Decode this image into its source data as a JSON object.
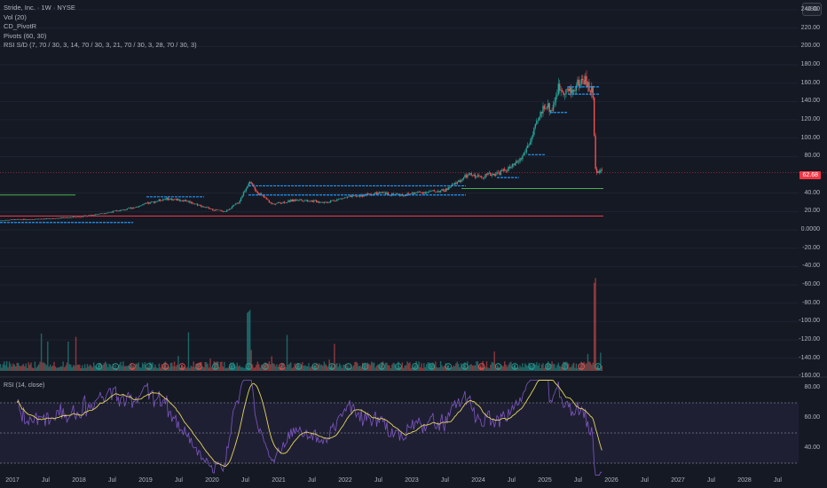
{
  "legend": {
    "symbol": "Stride, Inc. · 1W · NYSE",
    "volume": "Vol (20)",
    "pivot_r": "CD_PivotR",
    "pivots": "Pivots (60, 30)",
    "rsi_sd": "RSI S/D (7, 70 / 30, 3, 14, 70 / 30, 3, 21, 70 / 30, 3, 28, 70 / 30, 3)"
  },
  "currency": "USD",
  "last_price": "62.68",
  "price_axis": [
    "240.00",
    "220.00",
    "200.00",
    "180.00",
    "160.00",
    "140.00",
    "120.00",
    "100.00",
    "80.00",
    "40.00",
    "20.00",
    "0.0000",
    "-20.00",
    "-40.00",
    "-60.00",
    "-80.00",
    "-100.00",
    "-120.00",
    "-140.00",
    "-160.00"
  ],
  "rsi_panel": {
    "title": "RSI (14, close)",
    "axis": [
      "80.00",
      "60.00",
      "40.00"
    ],
    "bands": [
      70,
      50,
      30
    ]
  },
  "time_axis": [
    "2017",
    "Jul",
    "2018",
    "Jul",
    "2019",
    "Jul",
    "2020",
    "Jul",
    "2021",
    "Jul",
    "2022",
    "Jul",
    "2023",
    "Jul",
    "2024",
    "Jul",
    "2025",
    "Jul",
    "2026",
    "Jul",
    "2027",
    "Jul",
    "2028",
    "Jul"
  ],
  "colors": {
    "up": "#26a69a",
    "down": "#ef5350",
    "rsi": "#7e57c2",
    "rsi_ma": "#e6d55c",
    "pivot": "#2196f3",
    "support": "#4caf50",
    "resistance": "#f23645"
  },
  "earnings_marker": "E",
  "chart_data": {
    "type": "line",
    "title": "Stride, Inc. · 1W · NYSE",
    "price_keypoints": [
      [
        2016.8,
        10
      ],
      [
        2017,
        11
      ],
      [
        2017.5,
        12
      ],
      [
        2018,
        14
      ],
      [
        2018.7,
        22
      ],
      [
        2019,
        28
      ],
      [
        2019.3,
        34
      ],
      [
        2019.6,
        32
      ],
      [
        2020,
        22
      ],
      [
        2020.2,
        20
      ],
      [
        2020.4,
        30
      ],
      [
        2020.55,
        52
      ],
      [
        2020.7,
        40
      ],
      [
        2020.9,
        28
      ],
      [
        2021.3,
        33
      ],
      [
        2021.7,
        30
      ],
      [
        2022,
        35
      ],
      [
        2022.5,
        40
      ],
      [
        2022.9,
        38
      ],
      [
        2023,
        40
      ],
      [
        2023.5,
        43
      ],
      [
        2023.85,
        60
      ],
      [
        2024,
        58
      ],
      [
        2024.3,
        62
      ],
      [
        2024.5,
        68
      ],
      [
        2024.65,
        78
      ],
      [
        2024.8,
        100
      ],
      [
        2025,
        138
      ],
      [
        2025.1,
        130
      ],
      [
        2025.2,
        155
      ],
      [
        2025.4,
        150
      ],
      [
        2025.5,
        160
      ],
      [
        2025.6,
        165
      ],
      [
        2025.68,
        150
      ],
      [
        2025.72,
        155
      ],
      [
        2025.76,
        65
      ],
      [
        2025.85,
        62.68
      ]
    ],
    "ylim": [
      -160,
      240
    ],
    "support_levels": [
      38,
      40
    ],
    "resistance_levels": [
      15
    ],
    "rsi_ylim": [
      20,
      85
    ]
  }
}
